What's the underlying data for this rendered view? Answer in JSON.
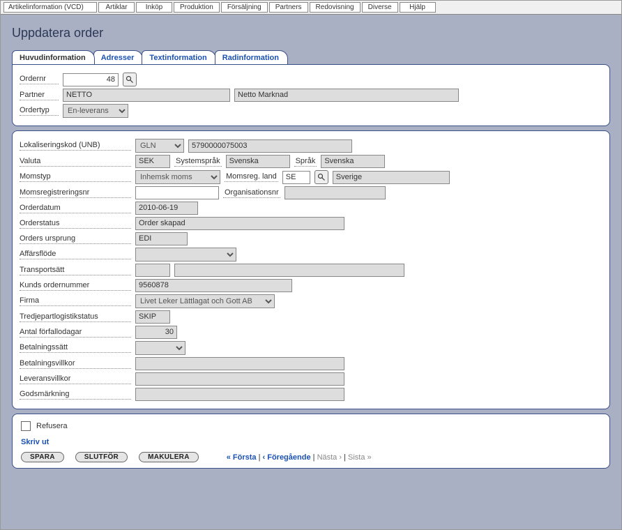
{
  "menu": {
    "items": [
      "Artikelinformation (VCD)",
      "Artiklar",
      "Inköp",
      "Produktion",
      "Försäljning",
      "Partners",
      "Redovisning",
      "Diverse",
      "Hjälp"
    ]
  },
  "title": "Uppdatera order",
  "tabs": [
    "Huvudinformation",
    "Adresser",
    "Textinformation",
    "Radinformation"
  ],
  "section1": {
    "ordernr_label": "Ordernr",
    "ordernr_value": "48",
    "partner_label": "Partner",
    "partner_code": "NETTO",
    "partner_name": "Netto Marknad",
    "ordertyp_label": "Ordertyp",
    "ordertyp_value": "En-leverans"
  },
  "section2": {
    "unb_label": "Lokaliseringskod (UNB)",
    "unb_type": "GLN",
    "unb_value": "5790000075003",
    "valuta_label": "Valuta",
    "valuta_value": "SEK",
    "syssprak_label": "Systemspråk",
    "syssprak_value": "Svenska",
    "sprak_label": "Språk",
    "sprak_value": "Svenska",
    "momstyp_label": "Momstyp",
    "momstyp_value": "Inhemsk moms",
    "momsreg_land_label": "Momsreg. land",
    "momsreg_land_value": "SE",
    "momsreg_land_name": "Sverige",
    "momsregnr_label": "Momsregistreringsnr",
    "momsregnr_value": "",
    "orgnr_label": "Organisationsnr",
    "orgnr_value": "",
    "orderdatum_label": "Orderdatum",
    "orderdatum_value": "2010-06-19",
    "orderstatus_label": "Orderstatus",
    "orderstatus_value": "Order skapad",
    "ursprung_label": "Orders ursprung",
    "ursprung_value": "EDI",
    "affarsflode_label": "Affärsflöde",
    "affarsflode_value": "",
    "transport_label": "Transportsätt",
    "transport_code": "",
    "transport_name": "",
    "kundord_label": "Kunds ordernummer",
    "kundord_value": "9560878",
    "firma_label": "Firma",
    "firma_value": "Livet Leker Lättlagat och Gott AB",
    "tredjepart_label": "Tredjepartlogistikstatus",
    "tredjepart_value": "SKIP",
    "forfall_label": "Antal förfallodagar",
    "forfall_value": "30",
    "betsatt_label": "Betalningssätt",
    "betsatt_value": "",
    "betvillkor_label": "Betalningsvillkor",
    "betvillkor_value": "",
    "levvillkor_label": "Leveransvillkor",
    "levvillkor_value": "",
    "godsmark_label": "Godsmärkning",
    "godsmark_value": ""
  },
  "footer": {
    "refusera_label": "Refusera",
    "skrivut_label": "Skriv ut",
    "spara": "SPARA",
    "slutfor": "SLUTFÖR",
    "makulera": "MAKULERA",
    "pager_first": "« Första",
    "pager_prev": "‹ Föregående",
    "pager_next": "Nästa ›",
    "pager_last": "Sista »"
  }
}
